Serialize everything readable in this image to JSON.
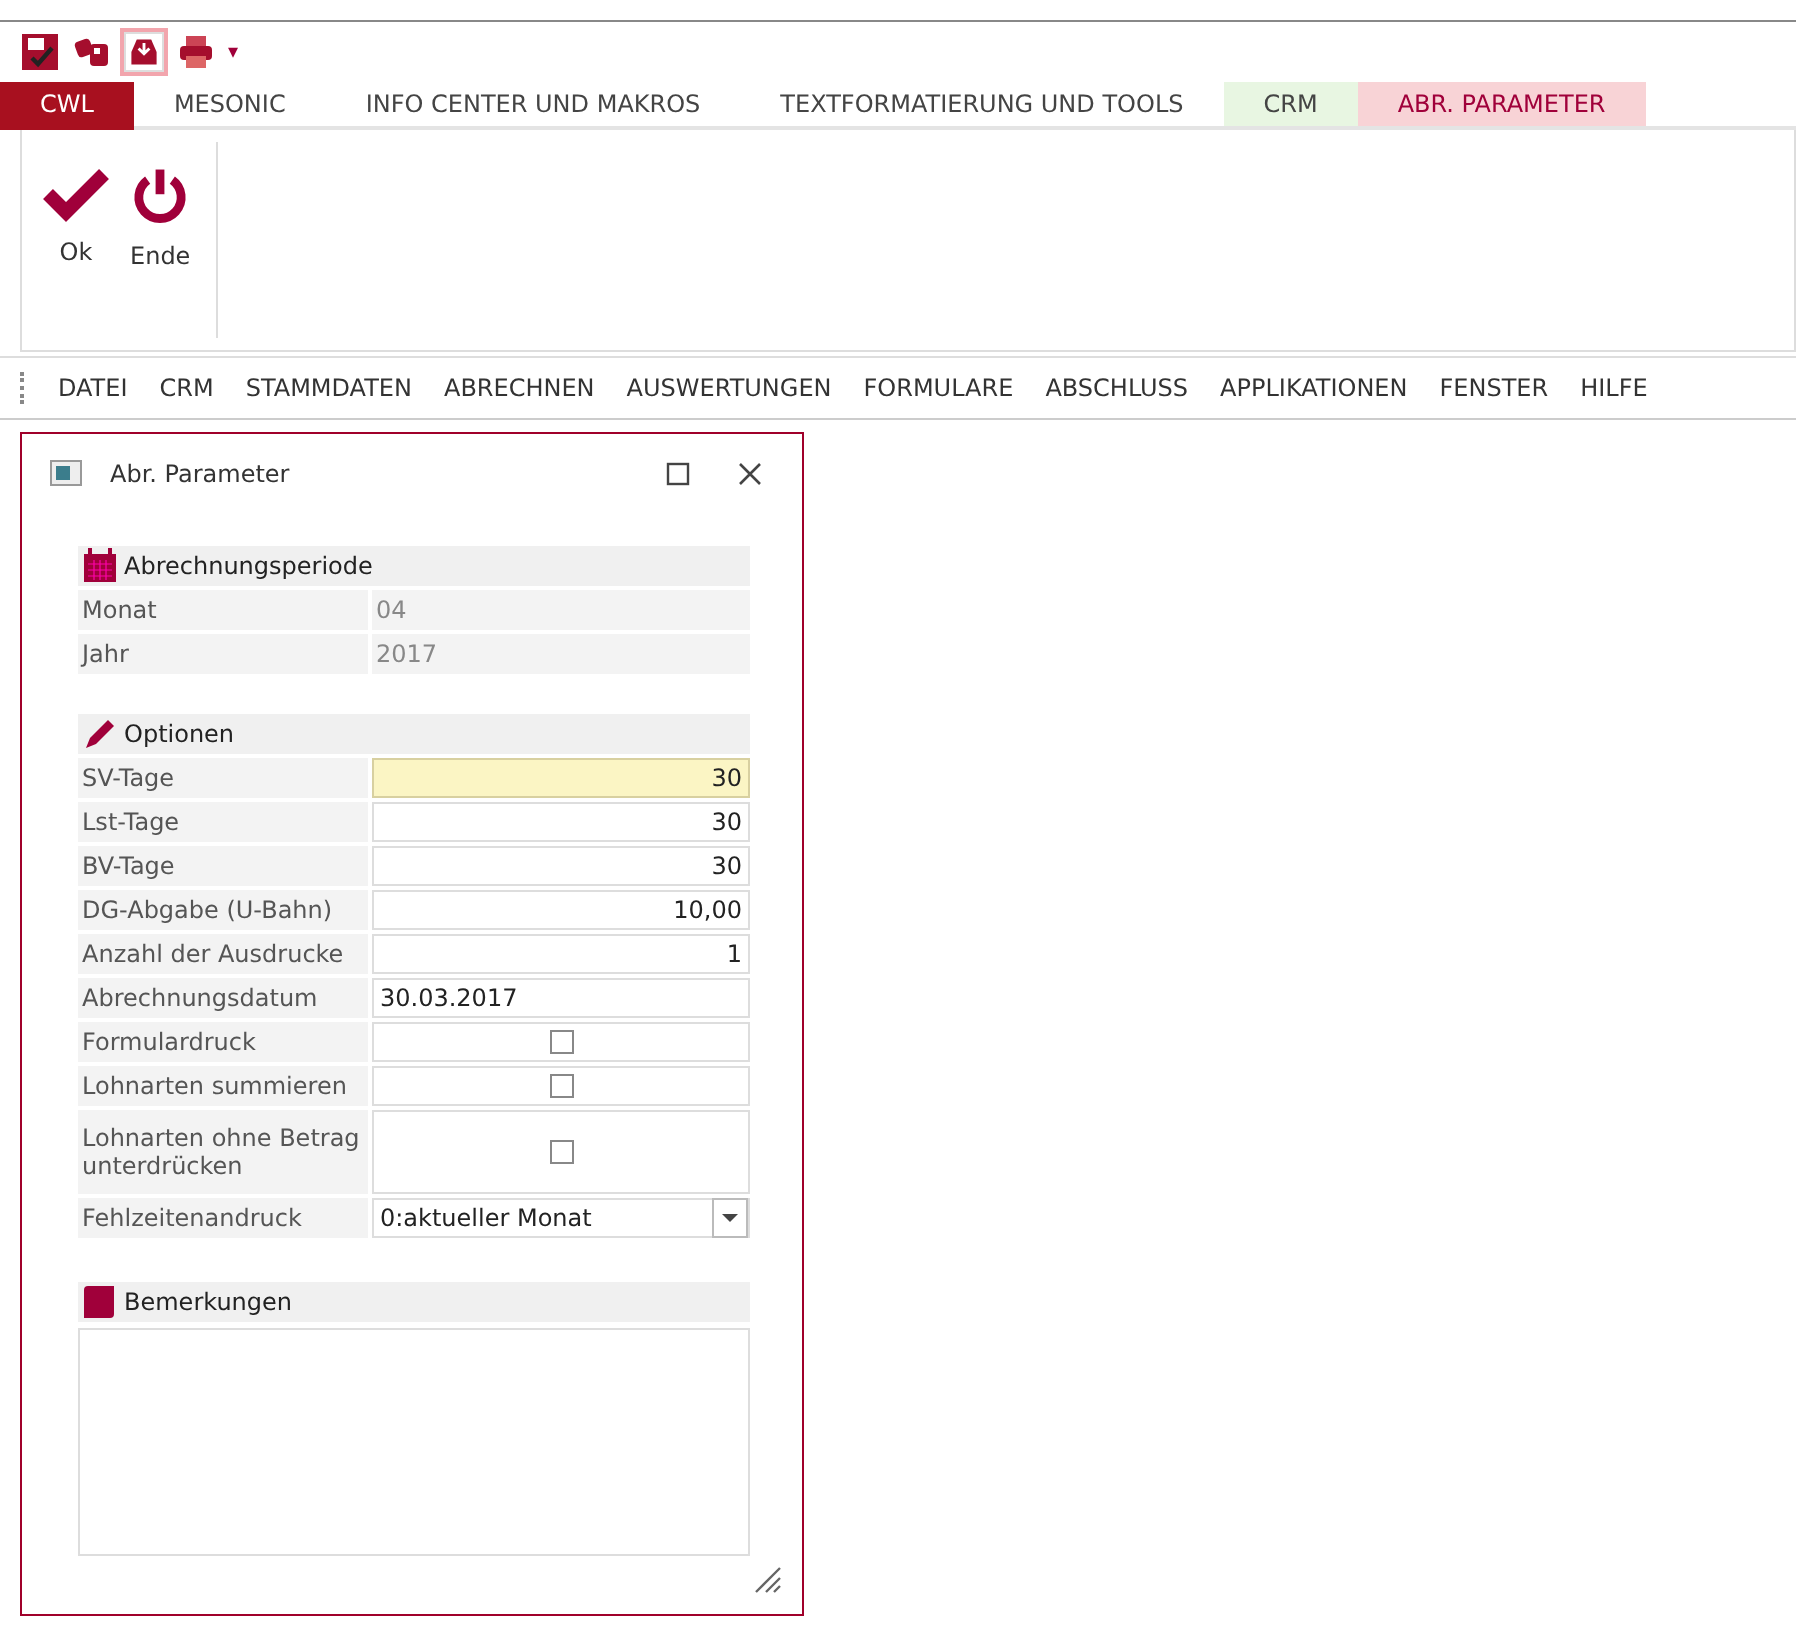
{
  "quick_access": {
    "overflow": "▾"
  },
  "tabs": [
    {
      "label": "CWL",
      "selected": true
    },
    {
      "label": "MESONIC",
      "selected": false
    },
    {
      "label": "INFO CENTER UND MAKROS",
      "selected": false
    },
    {
      "label": "TEXTFORMATIERUNG UND TOOLS",
      "selected": false
    },
    {
      "label": "CRM",
      "selected": false,
      "color": "#e8f6e2"
    },
    {
      "label": "ABR. PARAMETER",
      "selected": false,
      "color": "#f8d3d6"
    }
  ],
  "ribbon": {
    "buttons": [
      {
        "label": "Ok",
        "kind": "check"
      },
      {
        "label": "Ende",
        "kind": "power"
      }
    ]
  },
  "menu": [
    "DATEI",
    "CRM",
    "STAMMDATEN",
    "ABRECHNEN",
    "AUSWERTUNGEN",
    "FORMULARE",
    "ABSCHLUSS",
    "APPLIKATIONEN",
    "FENSTER",
    "HILFE"
  ],
  "dialog": {
    "title": "Abr. Parameter",
    "period": {
      "heading": "Abrechnungsperiode",
      "rows": [
        {
          "label": "Monat",
          "value": "04"
        },
        {
          "label": "Jahr",
          "value": "2017"
        }
      ]
    },
    "options": {
      "heading": "Optionen",
      "rows": [
        {
          "label": "SV-Tage",
          "kind": "number",
          "value": "30",
          "focused": true
        },
        {
          "label": "Lst-Tage",
          "kind": "number",
          "value": "30",
          "focused": false
        },
        {
          "label": "BV-Tage",
          "kind": "number",
          "value": "30",
          "focused": false
        },
        {
          "label": "DG-Abgabe (U-Bahn)",
          "kind": "number",
          "value": "10,00",
          "focused": false
        },
        {
          "label": "Anzahl der Ausdrucke",
          "kind": "number",
          "value": "1",
          "focused": false
        },
        {
          "label": "Abrechnungsdatum",
          "kind": "text",
          "value": "30.03.2017",
          "focused": false
        },
        {
          "label": "Formulardruck",
          "kind": "checkbox",
          "checked": false
        },
        {
          "label": "Lohnarten summieren",
          "kind": "checkbox",
          "checked": false
        },
        {
          "label": "Lohnarten ohne Betrag unterdrücken",
          "kind": "checkbox",
          "checked": false
        },
        {
          "label": "Fehlzeitenandruck",
          "kind": "select",
          "value": "0:aktueller Monat"
        }
      ]
    },
    "remarks": {
      "heading": "Bemerkungen"
    }
  }
}
